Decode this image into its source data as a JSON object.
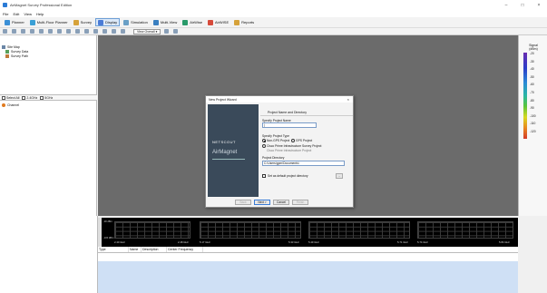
{
  "window": {
    "title": "AirMagnet Survey Professional Edition",
    "minimize": "–",
    "maximize": "□",
    "close": "×"
  },
  "menu": [
    "File",
    "Edit",
    "View",
    "Help"
  ],
  "toolbar": {
    "modes": [
      {
        "label": "Planner",
        "color": "#3a8fd6"
      },
      {
        "label": "Multi-Floor Planner",
        "color": "#3aa0d6"
      },
      {
        "label": "Survey",
        "color": "#d6a23a"
      },
      {
        "label": "Display",
        "color": "#4a7bd6",
        "active": true
      },
      {
        "label": "Simulation",
        "color": "#6aa0c6"
      },
      {
        "label": "Multi-View",
        "color": "#3a7fc0"
      },
      {
        "label": "AirWise",
        "color": "#2a9a6a"
      },
      {
        "label": "AirWISE",
        "color": "#d64a3a"
      },
      {
        "label": "Reports",
        "color": "#d6a23a"
      }
    ],
    "view_select": "View Overall"
  },
  "left_panel": {
    "tree": [
      {
        "label": "Site Map",
        "level": 0
      },
      {
        "label": "Survey Data",
        "level": 1
      },
      {
        "label": "Survey Path",
        "level": 1
      }
    ],
    "bands": [
      "Select All",
      "2.4GHz",
      "5GHz"
    ],
    "channel_label": "Channel"
  },
  "legend": {
    "title_line1": "Signal",
    "title_line2": "(dBm)",
    "ticks": [
      "-20",
      "-30",
      "-40",
      "-50",
      "-60",
      "-70",
      "-80",
      "-90",
      "-100",
      "-110",
      "-120"
    ]
  },
  "dialog": {
    "title": "New Project Wizard",
    "close": "×",
    "brand_netscout": "NETSCOUT",
    "brand_airmagnet": "AirMagnet",
    "heading": "Project Name and Directory",
    "name_label": "Specify Project Name",
    "name_value": "|",
    "type_label": "Specify Project Type",
    "type_options": [
      "Non-GPS Project",
      "GPS Project"
    ],
    "cisco_options": [
      "Cisco Prime Infrastructure Survey Project",
      "Cisco Prime Infrastructure Project"
    ],
    "dir_label": "Project Directory",
    "dir_value": "C:\\Users\\gpm\\Documents\\",
    "default_dir_label": "Set as default project directory",
    "browse": "...",
    "buttons": [
      "Back",
      "Next >",
      "Cancel",
      "Finish"
    ]
  },
  "canvas_message": "ject Wizard to create a new project.",
  "spectrum": {
    "panels": [
      {
        "left": "2.40 GHz",
        "right": "2.48 GHz"
      },
      {
        "left": "5.17 GHz",
        "right": "5.33 GHz"
      },
      {
        "left": "5.49 GHz",
        "right": "5.71 GHz"
      },
      {
        "left": "5.74 GHz",
        "right": "5.84 GHz"
      }
    ],
    "ylabels": [
      "-30 dBm",
      "-100 dBm"
    ]
  },
  "table": {
    "columns": [
      "Type",
      "Name",
      "Description",
      "Center Frequency"
    ]
  }
}
